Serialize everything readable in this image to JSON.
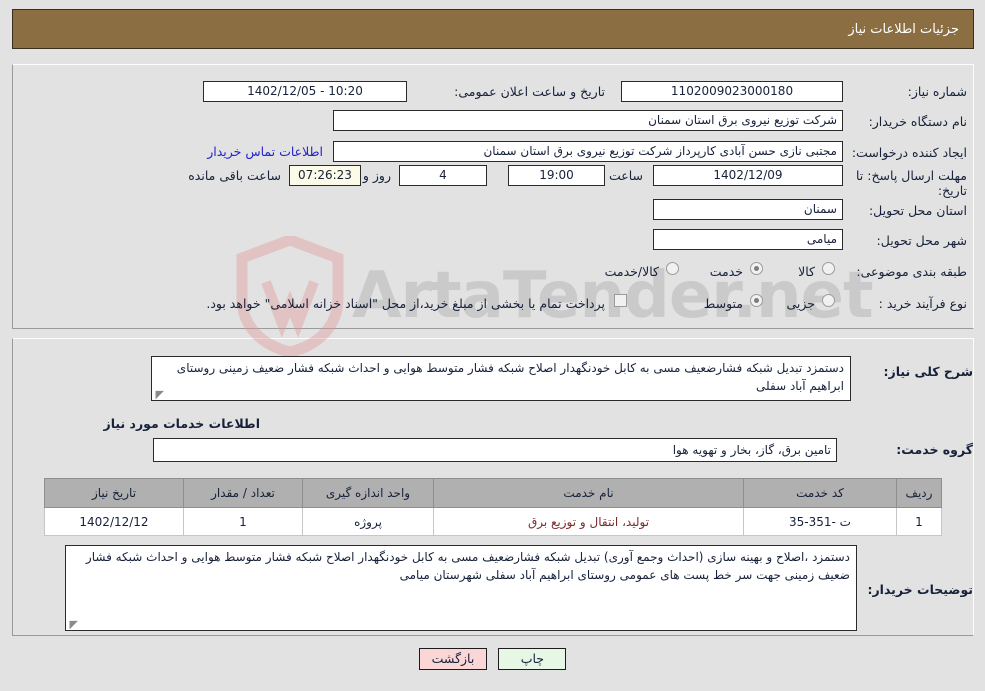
{
  "header": {
    "title": "جزئیات اطلاعات نیاز",
    "bg_color": "#8b6f43"
  },
  "watermark": {
    "text": "ArtaTender.net",
    "shield_color": "#e8b4b4"
  },
  "top_panel": {
    "need_number": {
      "label": "شماره نیاز:",
      "value": "1102009023000180"
    },
    "public_announce": {
      "label": "تاریخ و ساعت اعلان عمومی:",
      "value": "10:20 - 1402/12/05"
    },
    "buyer_org": {
      "label": "نام دستگاه خریدار:",
      "value": "شرکت توزیع نیروی برق استان سمنان"
    },
    "requester": {
      "label": "ایجاد کننده درخواست:",
      "value": "مجتبی نازی حسن آبادی کارپرداز شرکت توزیع نیروی برق استان سمنان"
    },
    "contact_link": "اطلاعات تماس خریدار",
    "deadline": {
      "label": "مهلت ارسال پاسخ: تا تاریخ:",
      "date": "1402/12/09",
      "time_label": "ساعت",
      "time": "19:00",
      "days": "4",
      "days_label": "روز و",
      "remaining": "07:26:23",
      "remaining_label": "ساعت باقی مانده"
    },
    "province": {
      "label": "استان محل تحویل:",
      "value": "سمنان"
    },
    "city": {
      "label": "شهر محل تحویل:",
      "value": "میامی"
    },
    "category": {
      "label": "طبقه بندی موضوعی:",
      "options": [
        "کالا",
        "خدمت",
        "کالا/خدمت"
      ],
      "selected": "خدمت"
    },
    "purchase_type": {
      "label": "نوع فرآیند خرید :",
      "options": [
        "جزیی",
        "متوسط"
      ],
      "selected": "متوسط"
    },
    "treasury_note": {
      "text": "پرداخت تمام یا بخشی از مبلغ خرید،از محل \"اسناد خزانه اسلامی\" خواهد بود.",
      "checked": false
    }
  },
  "mid_panel": {
    "general_desc": {
      "label": "شرح کلی نیاز:",
      "value": "دستمزد تبدیل شبکه فشارضعیف مسی به کابل خودنگهدار اصلاح شبکه فشار متوسط هوایی و احداث شبکه فشار ضعیف زمینی روستای ابراهیم آباد سفلی"
    },
    "services_heading": "اطلاعات خدمات مورد نیاز",
    "service_group": {
      "label": "گروه خدمت:",
      "value": "تامین برق، گاز، بخار و تهویه هوا"
    },
    "table": {
      "columns": [
        "ردیف",
        "کد خدمت",
        "نام خدمت",
        "واحد اندازه گیری",
        "تعداد / مقدار",
        "تاریخ نیاز"
      ],
      "rows": [
        {
          "index": "1",
          "code": "ت -351-35",
          "name": "تولید، انتقال و توزیع برق",
          "unit": "پروژه",
          "quantity": "1",
          "need_date": "1402/12/12"
        }
      ]
    },
    "buyer_notes": {
      "label": "توضیحات خریدار:",
      "value": "دستمزد ،اصلاح و بهینه سازی (احداث وجمع آوری) تبدیل شبکه فشارضعیف مسی به کابل خودنگهدار اصلاح شبکه فشار متوسط هوایی و احداث شبکه فشار ضعیف زمینی جهت سر خط پست های عمومی روستای ابراهیم آباد سفلی شهرستان میامی"
    }
  },
  "footer": {
    "print_label": "چاپ",
    "back_label": "بازگشت"
  }
}
